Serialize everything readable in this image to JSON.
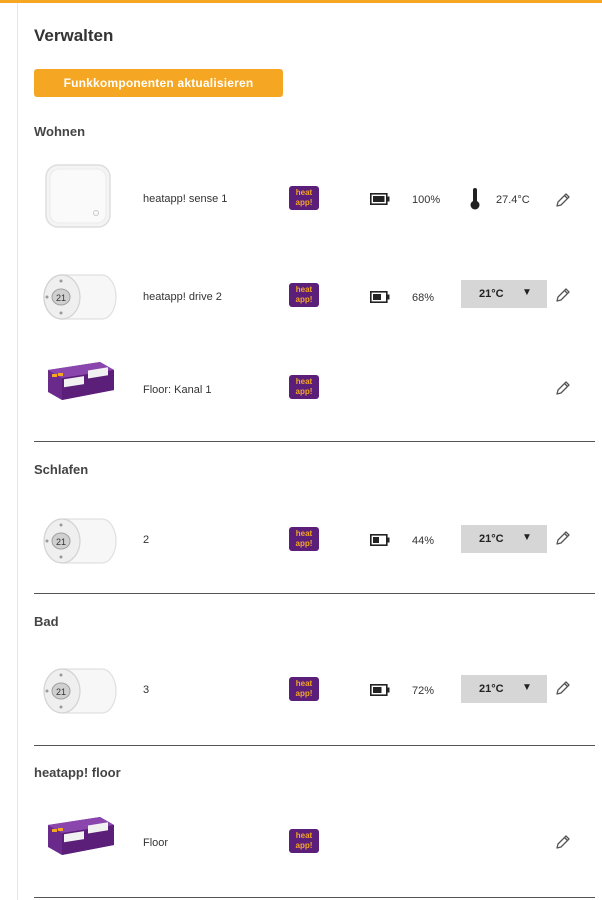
{
  "page": {
    "title": "Verwalten",
    "refresh_button": "Funkkomponenten aktualisieren"
  },
  "colors": {
    "accent": "#f5a623",
    "brand_purple": "#5b1f7a",
    "select_bg": "#d6d6d6"
  },
  "brand_logo": {
    "line1": "heat",
    "line2": "app!"
  },
  "rooms": [
    {
      "title": "Wohnen",
      "devices": [
        {
          "type": "sensor",
          "name": "heatapp! sense 1",
          "battery": "100%",
          "temperature": "27.4°C"
        },
        {
          "type": "drive",
          "name": "heatapp! drive 2",
          "battery": "68%",
          "setpoint": "21°C"
        },
        {
          "type": "floor",
          "name": "Floor: Kanal 1"
        }
      ]
    },
    {
      "title": "Schlafen",
      "devices": [
        {
          "type": "drive",
          "name": "2",
          "battery": "44%",
          "setpoint": "21°C"
        }
      ]
    },
    {
      "title": "Bad",
      "devices": [
        {
          "type": "drive",
          "name": "3",
          "battery": "72%",
          "setpoint": "21°C"
        }
      ]
    },
    {
      "title": "heatapp! floor",
      "devices": [
        {
          "type": "floor",
          "name": "Floor"
        }
      ]
    }
  ],
  "icons": {
    "battery": "battery-icon",
    "thermometer": "thermometer-icon",
    "edit": "pencil-icon",
    "dropdown": "▼"
  }
}
